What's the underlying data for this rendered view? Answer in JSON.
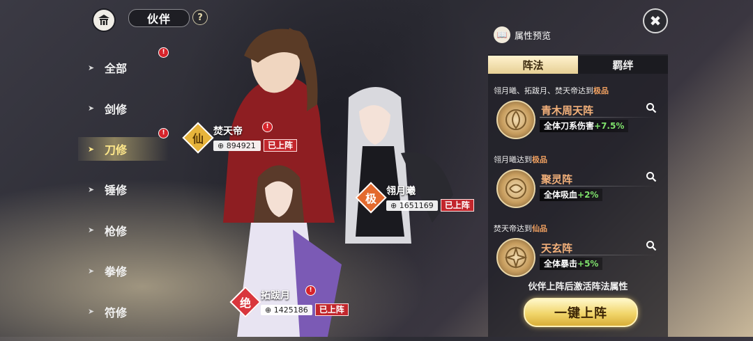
{
  "header": {
    "title": "伙伴",
    "help": "?",
    "close": "✖"
  },
  "nav": {
    "items": [
      {
        "label": "全部",
        "badge": "!"
      },
      {
        "label": "剑修",
        "badge": ""
      },
      {
        "label": "刀修",
        "badge": "!"
      },
      {
        "label": "锤修",
        "badge": ""
      },
      {
        "label": "枪修",
        "badge": ""
      },
      {
        "label": "拳修",
        "badge": ""
      },
      {
        "label": "符修",
        "badge": ""
      }
    ],
    "active_index": 2
  },
  "characters": [
    {
      "name": "焚天帝",
      "rank": "仙",
      "power": "894921",
      "status": "已上阵",
      "badge": "!"
    },
    {
      "name": "翎月曦",
      "rank": "极",
      "power": "1651169",
      "status": "已上阵",
      "badge": ""
    },
    {
      "name": "拓跋月",
      "rank": "绝",
      "power": "1425186",
      "status": "已上阵",
      "badge": "!"
    }
  ],
  "panel": {
    "preview_title": "属性预览",
    "tabs": [
      "阵法",
      "羁绊"
    ],
    "active_tab": 0,
    "formations": [
      {
        "condition_prefix": "翎月曦、拓跋月、焚天帝达到",
        "quality": "极品",
        "name": "青木周天阵",
        "effect": "全体刀系伤害",
        "bonus": "+7.5%"
      },
      {
        "condition_prefix": "翎月曦达到",
        "quality": "极品",
        "name": "聚灵阵",
        "effect": "全体吸血",
        "bonus": "+2%"
      },
      {
        "condition_prefix": "焚天帝达到",
        "quality": "仙品",
        "name": "天玄阵",
        "effect": "全体暴击",
        "bonus": "+5%"
      }
    ],
    "note": "伙伴上阵后激活阵法属性",
    "deploy_button": "一键上阵"
  },
  "colors": {
    "accent_gold": "#f1d56a",
    "quality_orange": "#f0a060",
    "bonus_green": "#7ee06b",
    "deployed_red": "#c2262c"
  }
}
